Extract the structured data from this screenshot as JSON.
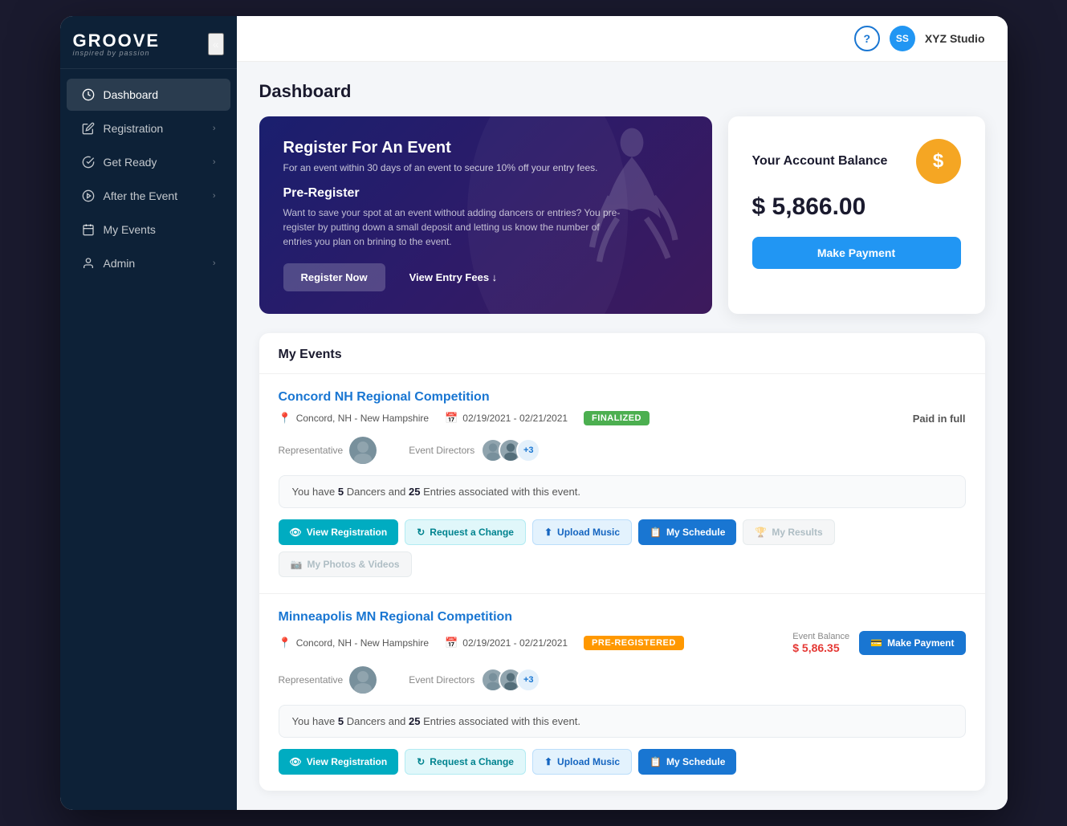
{
  "app": {
    "logo_main": "GROOVE",
    "logo_sub": "inspired by passion",
    "collapse_label": "«"
  },
  "sidebar": {
    "items": [
      {
        "id": "dashboard",
        "label": "Dashboard",
        "icon": "speedometer",
        "active": true,
        "has_chevron": false
      },
      {
        "id": "registration",
        "label": "Registration",
        "icon": "pencil",
        "active": false,
        "has_chevron": true
      },
      {
        "id": "get-ready",
        "label": "Get Ready",
        "icon": "check-circle",
        "active": false,
        "has_chevron": true
      },
      {
        "id": "after-event",
        "label": "After the Event",
        "icon": "play-circle",
        "active": false,
        "has_chevron": true
      },
      {
        "id": "my-events",
        "label": "My Events",
        "icon": "calendar",
        "active": false,
        "has_chevron": false
      },
      {
        "id": "admin",
        "label": "Admin",
        "icon": "person",
        "active": false,
        "has_chevron": true
      }
    ]
  },
  "topbar": {
    "help_label": "?",
    "user_initials": "SS",
    "user_name": "XYZ Studio"
  },
  "page": {
    "title": "Dashboard"
  },
  "register_card": {
    "title": "Register For An Event",
    "desc": "For an event within 30 days of an event to secure 10% off your entry fees.",
    "pre_register_title": "Pre-Register",
    "pre_register_desc": "Want to save your spot at an event without adding dancers or entries? You pre-register by putting down a small deposit and letting us know the number of entries you plan on brining to the event.",
    "btn_register": "Register Now",
    "btn_fees": "View Entry Fees ↓"
  },
  "balance_card": {
    "title": "Your Account Balance",
    "amount": "$ 5,866.00",
    "btn_payment": "Make Payment",
    "icon": "$"
  },
  "events": {
    "section_title": "My Events",
    "items": [
      {
        "name": "Concord NH Regional Competition",
        "location": "Concord, NH - New Hampshire",
        "dates": "02/19/2021 - 02/21/2021",
        "badge_text": "FINALIZED",
        "badge_type": "finalized",
        "paid_status": "Paid in full",
        "dancers_count": "5",
        "entries_count": "25",
        "summary": "You have 5 Dancers and 25 Entries associated with this event.",
        "extra_directors": "+3",
        "actions": [
          {
            "label": "View Registration",
            "type": "teal",
            "icon": "eye"
          },
          {
            "label": "Request a Change",
            "type": "outline-teal",
            "icon": "refresh"
          },
          {
            "label": "Upload Music",
            "type": "outline-blue",
            "icon": "upload"
          },
          {
            "label": "My Schedule",
            "type": "blue",
            "icon": "calendar"
          },
          {
            "label": "My Results",
            "type": "gray",
            "icon": "trophy",
            "disabled": true
          },
          {
            "label": "My Photos & Videos",
            "type": "gray",
            "icon": "camera",
            "disabled": true
          }
        ]
      },
      {
        "name": "Minneapolis MN Regional Competition",
        "location": "Concord, NH - New Hampshire",
        "dates": "02/19/2021 - 02/21/2021",
        "badge_text": "PRE-REGISTERED",
        "badge_type": "pre-registered",
        "paid_status": "",
        "event_balance_label": "Event Balance",
        "event_balance_amount": "$ 5,86.35",
        "dancers_count": "5",
        "entries_count": "25",
        "summary": "You have 5 Dancers and 25 Entries associated with this event.",
        "extra_directors": "+3",
        "actions": [
          {
            "label": "View Registration",
            "type": "teal",
            "icon": "eye"
          },
          {
            "label": "Request a Change",
            "type": "outline-teal",
            "icon": "refresh"
          },
          {
            "label": "Upload Music",
            "type": "outline-blue",
            "icon": "upload"
          },
          {
            "label": "My Schedule",
            "type": "blue",
            "icon": "calendar"
          }
        ],
        "make_payment_btn": "Make Payment"
      }
    ]
  }
}
